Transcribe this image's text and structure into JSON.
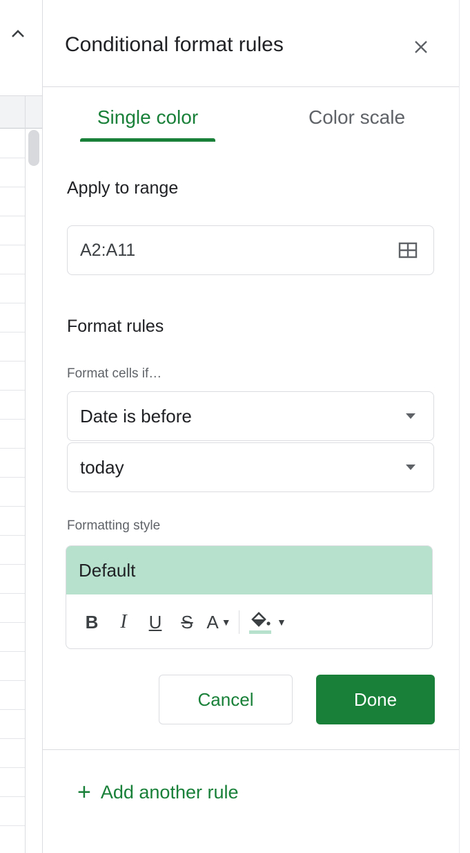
{
  "panel": {
    "title": "Conditional format rules",
    "tabs": [
      {
        "label": "Single color",
        "active": true
      },
      {
        "label": "Color scale",
        "active": false
      }
    ],
    "apply_to_range": {
      "label": "Apply to range",
      "value": "A2:A11",
      "icon": "grid-select-icon"
    },
    "format_rules": {
      "label": "Format rules",
      "condition_label": "Format cells if…",
      "condition_value": "Date is before",
      "date_value": "today"
    },
    "formatting_style": {
      "label": "Formatting style",
      "preview_text": "Default",
      "preview_color": "#b7e1cd",
      "toolbar": {
        "bold": "B",
        "italic": "I",
        "underline": "U",
        "strikethrough": "S",
        "text_color": "A"
      }
    },
    "buttons": {
      "cancel": "Cancel",
      "done": "Done"
    },
    "add_rule": "Add another rule"
  },
  "colors": {
    "accent": "#188038",
    "border": "#dadce0",
    "muted_text": "#5f6368"
  }
}
